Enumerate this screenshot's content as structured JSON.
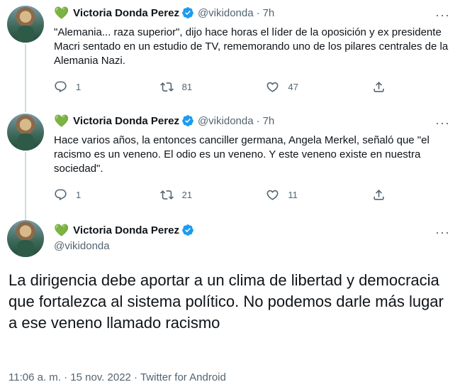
{
  "tweets": [
    {
      "author_name": "Victoria Donda Perez",
      "handle": "@vikidonda",
      "separator": "·",
      "time": "7h",
      "text": "\"Alemania... raza superior\", dijo hace horas el líder de la oposición y ex presidente Macri sentado en un estudio de TV, rememorando uno de los pilares centrales de la Alemania Nazi.",
      "replies": "1",
      "retweets": "81",
      "likes": "47"
    },
    {
      "author_name": "Victoria Donda Perez",
      "handle": "@vikidonda",
      "separator": "·",
      "time": "7h",
      "text": "Hace varios años, la entonces canciller germana, Angela Merkel, señaló que \"el racismo es un veneno. El odio es un veneno. Y este veneno existe en nuestra sociedad\".",
      "replies": "1",
      "retweets": "21",
      "likes": "11"
    }
  ],
  "main_tweet": {
    "author_name": "Victoria Donda Perez",
    "handle": "@vikidonda",
    "text": "La dirigencia debe aportar a un clima de libertad y democracia que fortalezca al sistema político. No podemos darle más lugar a ese veneno llamado racismo",
    "timestamp": "11:06 a. m. · 15 nov. 2022",
    "meta_separator": " · ",
    "source": "Twitter for Android"
  },
  "icons": {
    "heart_emoji": "💚",
    "more": "···"
  },
  "colors": {
    "accent": "#1d9bf0",
    "secondary_text": "#536471",
    "heart_green": "#59b35b",
    "thread_line": "#cfd9de"
  }
}
